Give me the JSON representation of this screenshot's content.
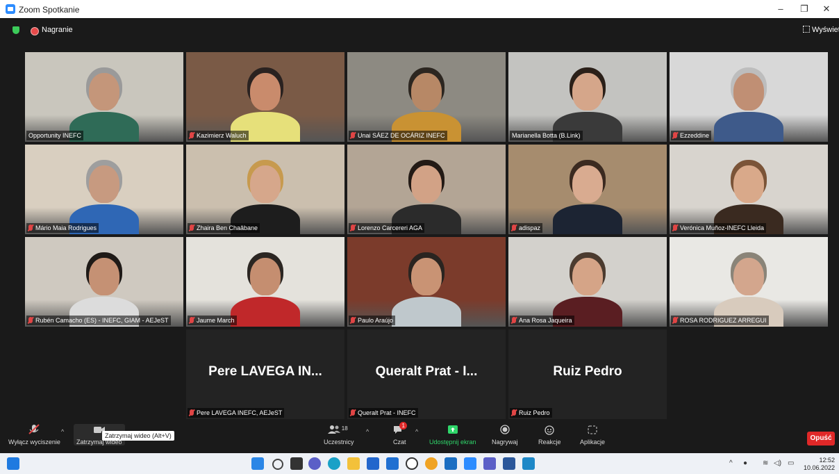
{
  "window": {
    "title": "Zoom Spotkanie",
    "minimize": "–",
    "restore": "❐",
    "close": "✕"
  },
  "topbar": {
    "recording_label": "Nagranie",
    "view_label": "Wyświetl"
  },
  "participants": [
    {
      "name": "Opportunity INEFC",
      "muted": false,
      "highlight": false,
      "wall": "#c9c6bd",
      "shirt": "#2f6b57",
      "skin": "#c4967a",
      "hair": "#9a9a9a"
    },
    {
      "name": "Kazimierz Waluch",
      "muted": true,
      "highlight": false,
      "wall": "#7a5a46",
      "shirt": "#e6e07a",
      "skin": "#c98b6c",
      "hair": "#2a2220"
    },
    {
      "name": "Unai SÁEZ DE OCÁRIZ INEFC",
      "muted": true,
      "highlight": false,
      "wall": "#8d8a82",
      "shirt": "#c99233",
      "skin": "#b78866",
      "hair": "#2c2620"
    },
    {
      "name": "Marianella Botta (B.Link)",
      "muted": false,
      "highlight": true,
      "wall": "#c3c3c0",
      "shirt": "#3a3a3a",
      "skin": "#d5a68a",
      "hair": "#2b2019"
    },
    {
      "name": "Ezzeddine",
      "muted": true,
      "highlight": false,
      "wall": "#d8d8d8",
      "shirt": "#3e5a8a",
      "skin": "#c08f74",
      "hair": "#bdbdbd"
    },
    {
      "name": "Mário Maia Rodrigues",
      "muted": true,
      "highlight": false,
      "wall": "#d9cfc0",
      "shirt": "#2f67b5",
      "skin": "#c79a80",
      "hair": "#9e9e9e"
    },
    {
      "name": "Zhaira Ben Chaâbane",
      "muted": true,
      "highlight": false,
      "wall": "#cbbfae",
      "shirt": "#1d1d1d",
      "skin": "#d6a78b",
      "hair": "#c79a4e"
    },
    {
      "name": "Lorenzo Carcereri AGA",
      "muted": true,
      "highlight": false,
      "wall": "#b3a595",
      "shirt": "#2b2b2b",
      "skin": "#d2a286",
      "hair": "#231a15"
    },
    {
      "name": "adispaz",
      "muted": true,
      "highlight": false,
      "wall": "#a68c6e",
      "shirt": "#1c2433",
      "skin": "#d9ab90",
      "hair": "#3b2a20"
    },
    {
      "name": "Verónica Muñoz-INEFC Lleida",
      "muted": true,
      "highlight": false,
      "wall": "#d8d4ce",
      "shirt": "#3a2a20",
      "skin": "#d9a98a",
      "hair": "#7b5438"
    },
    {
      "name": "Rubén Camacho (ES) - INEFC, GIAM - AEJeST",
      "muted": true,
      "highlight": false,
      "wall": "#cfc9c0",
      "shirt": "#dcdcdc",
      "skin": "#c59174",
      "hair": "#1f1a17"
    },
    {
      "name": "Jaume March",
      "muted": true,
      "highlight": false,
      "wall": "#e4e2dc",
      "shirt": "#c0282a",
      "skin": "#c58e70",
      "hair": "#2b2622"
    },
    {
      "name": "Paulo Araújo",
      "muted": true,
      "highlight": false,
      "wall": "#7b3b2b",
      "shirt": "#bfc8cc",
      "skin": "#c99374",
      "hair": "#2a2420"
    },
    {
      "name": "Ana Rosa Jaqueira",
      "muted": true,
      "highlight": false,
      "wall": "#d3d1cc",
      "shirt": "#5a1e22",
      "skin": "#d5a487",
      "hair": "#4b3b2f"
    },
    {
      "name": "ROSA RODRIGUEZ ARREGUI",
      "muted": true,
      "highlight": false,
      "wall": "#e9e8e4",
      "shirt": "#d8cbbd",
      "skin": "#d3a68d",
      "hair": "#8a8478"
    }
  ],
  "text_tiles": [
    {
      "display": "Pere LAVEGA IN...",
      "name": "Pere LAVEGA INEFC, AEJeST"
    },
    {
      "display": "Queralt Prat - I...",
      "name": "Queralt Prat - INEFC"
    },
    {
      "display": "Ruiz Pedro",
      "name": "Ruiz Pedro"
    }
  ],
  "controls": {
    "unmute": "Wyłącz wyciszenie",
    "stop_video": "Zatrzymaj wideo",
    "tooltip": "Zatrzymaj wideo (Alt+V)",
    "participants": "Uczestnicy",
    "participants_count": "18",
    "chat": "Czat",
    "chat_badge": "1",
    "share": "Udostępnij ekran",
    "record": "Nagrywaj",
    "reactions": "Reakcje",
    "apps": "Aplikacje",
    "leave": "Opuść"
  },
  "colors": {
    "share_green": "#2fd66a",
    "leave_red": "#e02828",
    "highlight": "#a9e84a"
  },
  "taskbar": {
    "time": "12:52",
    "date": "10.06.2022"
  }
}
